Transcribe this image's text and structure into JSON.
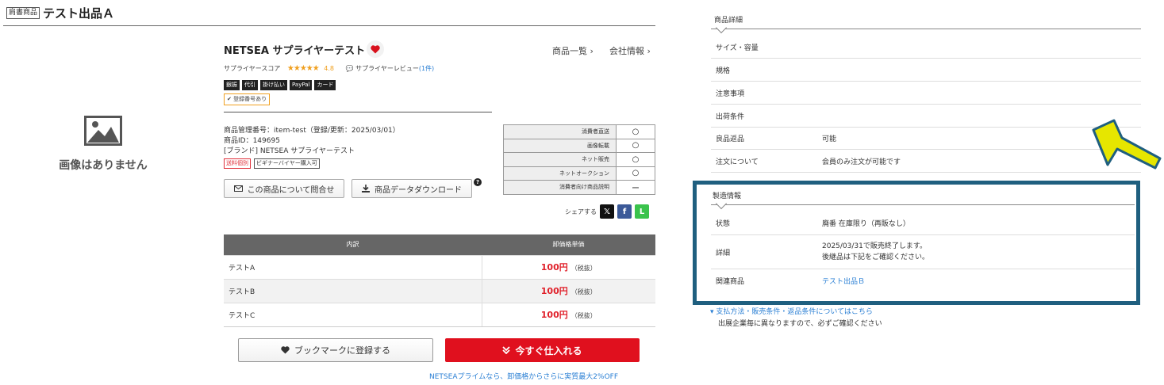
{
  "header": {
    "category_badge": "肩書商品",
    "title": "テスト出品Ａ"
  },
  "image_placeholder": {
    "text": "画像はありません"
  },
  "product": {
    "name": "NETSEA サプライヤーテスト",
    "nav_list": "商品一覧 ›",
    "nav_company": "会社情報 ›",
    "supplier_score_label": "サプライヤースコア",
    "stars": "★★★★★",
    "score": "4.8",
    "review_label": "サプライヤーレビュー",
    "review_count": "(1件)",
    "tags": [
      "銀振",
      "代引",
      "掛け払い",
      "PayPal",
      "カード"
    ],
    "registration_badge": "✔ 登録番号あり",
    "management_no": "商品管理番号：item-test（登録/更新：2025/03/01）",
    "product_id": "商品ID：149695",
    "brand": "[ブランド] NETSEA サプライヤーテスト",
    "flag_shipping": "送料個別",
    "flag_beginner": "ビギナーバイヤー購入可",
    "inquiry_button": "この商品について問合せ",
    "download_button": "商品データダウンロード",
    "help": "?"
  },
  "attributes": [
    {
      "label": "消費者直送",
      "value": "○"
    },
    {
      "label": "画像転載",
      "value": "○"
    },
    {
      "label": "ネット販売",
      "value": "○"
    },
    {
      "label": "ネットオークション",
      "value": "○"
    },
    {
      "label": "消費者向け商品説明",
      "value": "ー"
    }
  ],
  "share": {
    "label": "シェアする",
    "x": "𝕏",
    "facebook": "f",
    "line": "L"
  },
  "price_table": {
    "col_breakdown": "内訳",
    "col_price": "卸価格単価",
    "tax_label": "（税抜）",
    "rows": [
      {
        "name": "テストA",
        "price": "100円"
      },
      {
        "name": "テストB",
        "price": "100円"
      },
      {
        "name": "テストC",
        "price": "100円"
      }
    ]
  },
  "actions": {
    "bookmark": "ブックマークに登録する",
    "buy_now": "今すぐ仕入れる",
    "prime_note": "NETSEAプライムなら、卸価格からさらに実質最大2%OFF"
  },
  "details": {
    "title": "商品詳細",
    "rows": [
      {
        "label": "サイズ・容量",
        "value": ""
      },
      {
        "label": "規格",
        "value": ""
      },
      {
        "label": "注意事項",
        "value": ""
      },
      {
        "label": "出荷条件",
        "value": ""
      },
      {
        "label": "良品返品",
        "value": "可能"
      },
      {
        "label": "注文について",
        "value": "会員のみ注文が可能です"
      }
    ]
  },
  "manufacturing": {
    "title": "製造情報",
    "status_label": "状態",
    "status_value": "廃番 在庫限り（再販なし）",
    "detail_label": "詳細",
    "detail_line1": "2025/03/31で販売終了します。",
    "detail_line2": "後継品は下記をご確認ください。",
    "related_label": "関連商品",
    "related_value": "テスト出品Ｂ"
  },
  "payment": {
    "link": "▾ 支払方法・販売条件・返品条件についてはこちら",
    "note": "出展企業毎に異なりますので、必ずご確認ください"
  },
  "colors": {
    "accent_red": "#e0101e",
    "link_blue": "#2a7fd4",
    "highlight_box": "#1f5f7f",
    "annotation_arrow": "#e6e600"
  }
}
